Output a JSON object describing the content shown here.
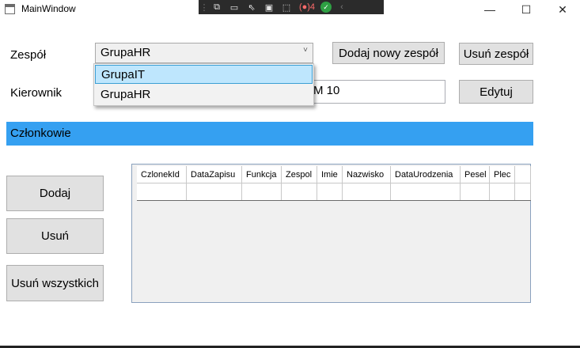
{
  "window": {
    "title": "MainWindow",
    "controls": {
      "minimize": "—",
      "maximize": "☐",
      "close": "✕"
    }
  },
  "debug_toolbar": {
    "icons": [
      "grip-icon",
      "live-visual-tree-icon",
      "camera-icon",
      "select-element-icon",
      "display-layout-icon",
      "track-focus-icon",
      "binding-failures-icon",
      "hot-reload-ok-icon",
      "collapse-icon"
    ],
    "binding_failures_count": "4"
  },
  "team": {
    "label": "Zespół",
    "selected": "GrupaHR",
    "add_button": "Dodaj nowy zespół",
    "remove_button": "Usuń zespół"
  },
  "dropdown": {
    "options": [
      {
        "label": "GrupaIT",
        "highlighted": true
      },
      {
        "label": "GrupaHR",
        "highlighted": false
      }
    ]
  },
  "manager": {
    "label": "Kierownik",
    "value_visible": "M 10",
    "edit_button": "Edytuj"
  },
  "members": {
    "header": "Członkowie",
    "add_button": "Dodaj",
    "remove_button": "Usuń",
    "remove_all_button": "Usuń wszystkich",
    "columns": [
      "CzlonekId",
      "DataZapisu",
      "Funkcja",
      "Zespol",
      "Imie",
      "Nazwisko",
      "DataUrodzenia",
      "Pesel",
      "Plec"
    ]
  },
  "colors": {
    "header_blue": "#35a0f1",
    "dropdown_highlight": "#bee6fd",
    "button_face": "#e1e1e1"
  }
}
